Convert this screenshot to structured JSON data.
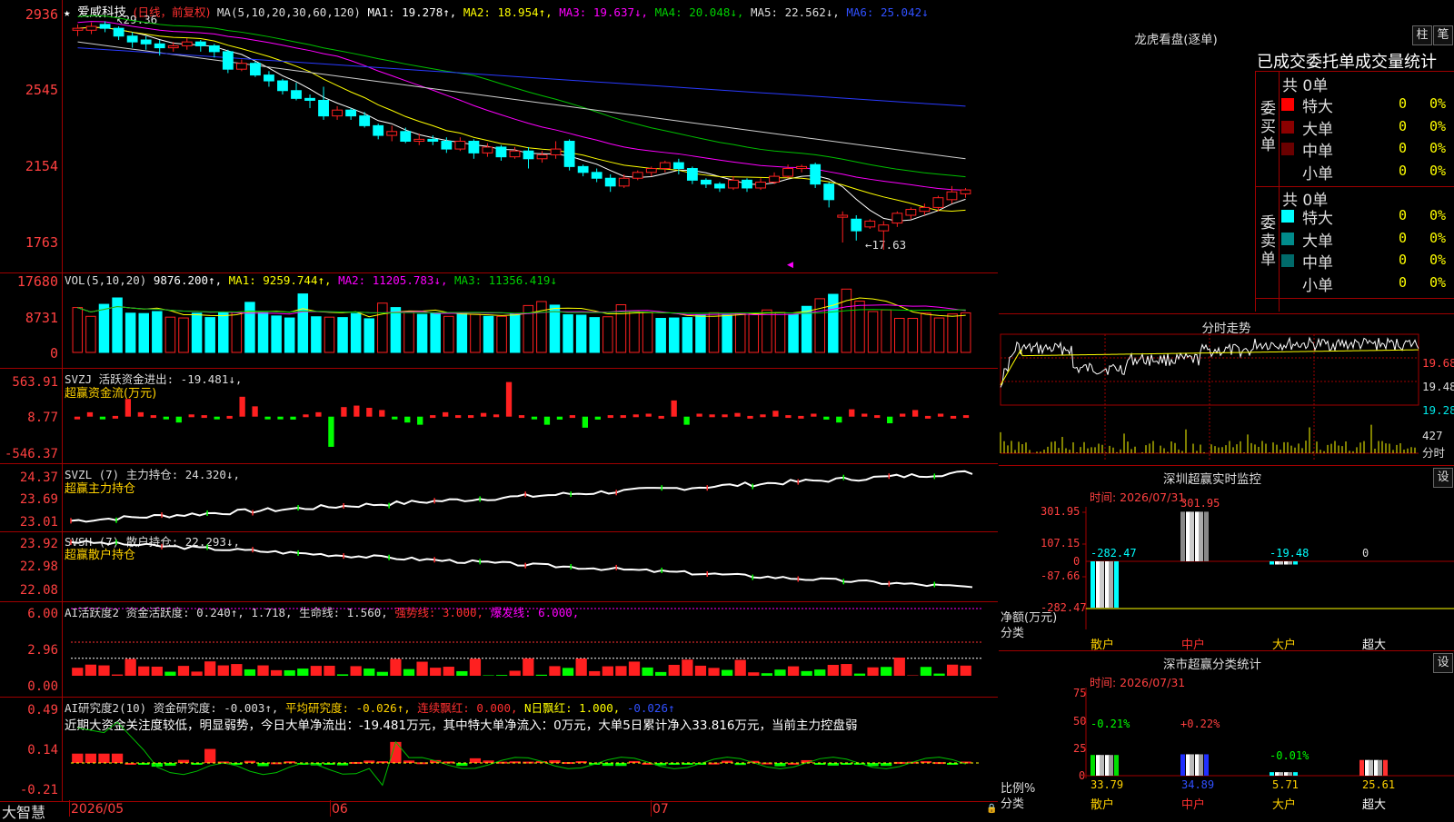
{
  "colors": {
    "up": "#ff2020",
    "down": "#00ffff",
    "ma1": "#ffffff",
    "ma2": "#ffff00",
    "ma3": "#ff00ff",
    "ma4": "#00c000",
    "ma5": "#cfcfcf",
    "ma6": "#2a3aff",
    "axis": "#ff4040",
    "grid": "#a00000"
  },
  "main": {
    "title": "爱威科技",
    "period": "(日线，前复权)",
    "ma_params": "MA(5,10,20,30,60,120)",
    "ma1": "MA1: 19.278↑,",
    "ma2": "MA2: 18.954↑,",
    "ma3": "MA3: 19.637↓,",
    "ma4": "MA4: 20.048↓,",
    "ma5": "MA5: 22.562↓,",
    "ma6": "MA6: 25.042↓",
    "high_marker": "29.36",
    "low_marker": "←17.63",
    "y_ticks": [
      "2936",
      "2545",
      "2154",
      "1763"
    ]
  },
  "vol": {
    "legend_name": "VOL(5,10,20)",
    "value": "9876.200↑,",
    "ma1": "MA1: 9259.744↑,",
    "ma2": "MA2: 11205.783↓,",
    "ma3": "MA3: 11356.419↓",
    "y_ticks": [
      "17680",
      "8731",
      "0"
    ]
  },
  "svzj": {
    "legend": "SVZJ  活跃资金进出: -19.481↓,",
    "sub": "超赢资金流(万元)",
    "y_ticks": [
      "563.91",
      "8.77",
      "-546.37"
    ]
  },
  "svzl": {
    "legend": "SVZL (7) 主力持仓: 24.320↓,",
    "sub": "超赢主力持仓",
    "y_ticks": [
      "24.37",
      "23.69",
      "23.01"
    ]
  },
  "svsh": {
    "legend": "SVSH (7) 散户持仓: 22.293↓,",
    "sub": "超赢散户持仓",
    "y_ticks": [
      "23.92",
      "22.98",
      "22.08"
    ]
  },
  "ai1": {
    "l1": "AI活跃度2 资金活跃度: 0.240↑,",
    "l2": "1.718,",
    "l3": "生命线: 1.560,",
    "l4": "强势线: 3.000,",
    "l5": "爆发线: 6.000,",
    "y_ticks": [
      "6.00",
      "2.96",
      "0.00"
    ]
  },
  "ai2": {
    "l1": "AI研究度2(10) 资金研究度: -0.003↑,",
    "l2": "平均研究度: -0.026↑,",
    "l3": "连续飘红: 0.000,",
    "l4": "N日飘红: 1.000,",
    "l5": "-0.026↑",
    "comment": "近期大资金关注度较低，明显弱势，今日大单净流出：-19.481万元，其中特大单净流入：0万元，大单5日累计净入33.816万元，当前主力控盘弱",
    "y_ticks": [
      "0.49",
      "0.14",
      "-0.21"
    ]
  },
  "bottom": {
    "brand": "大智慧",
    "dates": [
      "2026/05",
      "06",
      "07"
    ]
  },
  "dragon": {
    "title": "龙虎看盘(逐单)",
    "btn_bar": "柱",
    "btn_pen": "笔",
    "header": "已成交委托单成交量统计",
    "buy_label": "委买单",
    "sell_label": "委卖单",
    "buy_total": "共 0单",
    "sell_total": "共 0单",
    "buy_rows": [
      {
        "name": "特大",
        "count": "0",
        "pct": "0%",
        "color": "#ff0000"
      },
      {
        "name": "大单",
        "count": "0",
        "pct": "0%",
        "color": "#8b0000"
      },
      {
        "name": "中单",
        "count": "0",
        "pct": "0%",
        "color": "#6a0000"
      },
      {
        "name": "小单",
        "count": "0",
        "pct": "0%",
        "color": ""
      }
    ],
    "sell_rows": [
      {
        "name": "特大",
        "count": "0",
        "pct": "0%",
        "color": "#00ffff"
      },
      {
        "name": "大单",
        "count": "0",
        "pct": "0%",
        "color": "#008b8b"
      },
      {
        "name": "中单",
        "count": "0",
        "pct": "0%",
        "color": "#006a6a"
      },
      {
        "name": "小单",
        "count": "0",
        "pct": "0%",
        "color": ""
      }
    ]
  },
  "intraday": {
    "title": "分时走势",
    "prices": [
      "19.68",
      "19.48",
      "19.28"
    ],
    "vol_label": "427",
    "vol_unit": "分时"
  },
  "monitor": {
    "title": "深圳超赢实时监控",
    "btn": "设",
    "time": "时间: 2026/07/31",
    "y_ticks": [
      "301.95",
      "107.15",
      "0",
      "-87.66",
      "-282.47"
    ],
    "unit_label": "净额(万元)",
    "cat_label": "分类",
    "categories": [
      "散户",
      "中户",
      "大户",
      "超大"
    ],
    "values": [
      "-282.47",
      "301.95",
      "-19.48",
      "0"
    ]
  },
  "classify": {
    "title": "深市超赢分类统计",
    "btn": "设",
    "time": "时间: 2026/07/31",
    "y_ticks": [
      "75",
      "50",
      "25",
      "0"
    ],
    "unit_label": "比例%",
    "cat_label": "分类",
    "categories": [
      "散户",
      "中户",
      "大户",
      "超大"
    ],
    "changes": [
      "-0.21%",
      "+0.22%",
      "-0.01%",
      ""
    ],
    "values": [
      "33.79",
      "34.89",
      "5.71",
      "25.61"
    ]
  },
  "chart_data": [
    {
      "type": "candlestick",
      "title": "爱威科技 (日线，前复权)",
      "ylim": [
        17.3,
        29.8
      ],
      "candles": [
        [
          28.9,
          29.0,
          28.6,
          29.2
        ],
        [
          28.9,
          29.1,
          28.7,
          29.3
        ],
        [
          29.2,
          29.0,
          28.8,
          29.36
        ],
        [
          29.0,
          28.6,
          28.4,
          29.1
        ],
        [
          28.6,
          28.3,
          28.0,
          28.8
        ],
        [
          28.4,
          28.2,
          27.9,
          28.6
        ],
        [
          28.2,
          28.0,
          27.6,
          28.4
        ],
        [
          28.0,
          28.1,
          27.8,
          28.3
        ],
        [
          28.1,
          28.3,
          27.9,
          28.5
        ],
        [
          28.3,
          28.1,
          27.8,
          28.4
        ],
        [
          28.1,
          27.8,
          27.5,
          28.2
        ],
        [
          27.8,
          26.9,
          26.7,
          27.9
        ],
        [
          26.9,
          27.2,
          26.8,
          27.4
        ],
        [
          27.2,
          26.6,
          26.5,
          27.3
        ],
        [
          26.6,
          26.3,
          26.0,
          26.8
        ],
        [
          26.3,
          25.8,
          25.6,
          26.4
        ],
        [
          25.8,
          25.4,
          25.3,
          26.2
        ],
        [
          25.4,
          25.3,
          24.9,
          25.6
        ],
        [
          25.3,
          24.5,
          24.3,
          26.0
        ],
        [
          24.5,
          24.8,
          24.3,
          25.0
        ],
        [
          24.8,
          24.5,
          24.3,
          24.9
        ],
        [
          24.5,
          24.0,
          23.9,
          24.7
        ],
        [
          24.0,
          23.5,
          23.3,
          24.1
        ],
        [
          23.5,
          23.7,
          23.2,
          24.0
        ],
        [
          23.7,
          23.2,
          23.1,
          23.9
        ],
        [
          23.2,
          23.3,
          23.0,
          23.6
        ],
        [
          23.3,
          23.2,
          23.0,
          23.5
        ],
        [
          23.2,
          22.8,
          22.6,
          23.4
        ],
        [
          22.8,
          23.2,
          22.7,
          23.4
        ],
        [
          23.2,
          22.6,
          22.3,
          23.3
        ],
        [
          22.6,
          22.9,
          22.4,
          23.1
        ],
        [
          22.9,
          22.4,
          22.2,
          23.0
        ],
        [
          22.4,
          22.7,
          22.3,
          22.9
        ],
        [
          22.7,
          22.3,
          21.8,
          22.9
        ],
        [
          22.3,
          22.5,
          22.1,
          22.7
        ],
        [
          22.5,
          22.8,
          22.3,
          23.2
        ],
        [
          23.2,
          21.9,
          21.7,
          23.3
        ],
        [
          21.9,
          21.6,
          21.4,
          22.0
        ],
        [
          21.6,
          21.3,
          21.1,
          21.8
        ],
        [
          21.3,
          20.9,
          20.6,
          21.5
        ],
        [
          20.9,
          21.3,
          20.8,
          21.5
        ],
        [
          21.3,
          21.6,
          21.2,
          21.7
        ],
        [
          21.6,
          21.8,
          21.4,
          21.9
        ],
        [
          21.8,
          22.1,
          21.6,
          22.2
        ],
        [
          22.1,
          21.8,
          21.5,
          22.3
        ],
        [
          21.8,
          21.2,
          21.0,
          21.9
        ],
        [
          21.2,
          21.0,
          20.8,
          21.3
        ],
        [
          21.0,
          20.8,
          20.6,
          21.1
        ],
        [
          20.8,
          21.2,
          20.7,
          21.4
        ],
        [
          21.2,
          20.8,
          20.6,
          21.3
        ],
        [
          20.8,
          21.1,
          20.7,
          21.3
        ],
        [
          21.1,
          21.4,
          21.0,
          21.6
        ],
        [
          21.4,
          21.8,
          21.3,
          22.0
        ],
        [
          21.8,
          21.9,
          21.6,
          22.0
        ],
        [
          22.0,
          21.0,
          20.8,
          22.1
        ],
        [
          21.0,
          20.2,
          19.8,
          21.1
        ],
        [
          19.3,
          19.4,
          18.0,
          19.6
        ],
        [
          19.2,
          18.6,
          18.1,
          19.4
        ],
        [
          18.8,
          19.1,
          18.7,
          19.2
        ],
        [
          18.6,
          18.9,
          17.63,
          19.1
        ],
        [
          19.0,
          19.5,
          18.8,
          19.6
        ],
        [
          19.4,
          19.7,
          19.2,
          19.8
        ],
        [
          19.6,
          19.8,
          19.4,
          20.0
        ],
        [
          19.8,
          20.3,
          19.6,
          20.4
        ],
        [
          20.2,
          20.6,
          20.0,
          20.9
        ],
        [
          20.5,
          20.7,
          20.3,
          20.8
        ]
      ]
    },
    {
      "type": "bar",
      "title": "VOL(5,10,20)",
      "ylim": [
        0,
        17680
      ],
      "values": [
        11200,
        9000,
        12000,
        13600,
        9800,
        9700,
        10200,
        8800,
        8600,
        9800,
        8700,
        9900,
        10000,
        12500,
        9900,
        9100,
        8600,
        14600,
        8900,
        8800,
        8700,
        9700,
        8400,
        12300,
        11200,
        10100,
        9500,
        9800,
        9000,
        9600,
        9500,
        9000,
        9000,
        9700,
        11700,
        12700,
        11800,
        9400,
        9300,
        8700,
        8900,
        11900,
        10300,
        10000,
        8500,
        8600,
        8700,
        9400,
        9900,
        9300,
        9800,
        9600,
        10600,
        10000,
        9400,
        11500,
        13400,
        14500,
        15800,
        12800,
        10200,
        10600,
        8500,
        8500,
        9800,
        8600,
        9600,
        9876
      ]
    },
    {
      "type": "bar",
      "title": "超赢资金流(万元)",
      "ylim": [
        -546.37,
        563.91
      ],
      "values": [
        0,
        60,
        -20,
        10,
        240,
        60,
        20,
        -20,
        -80,
        30,
        20,
        -20,
        10,
        270,
        140,
        -20,
        -10,
        -40,
        30,
        60,
        -410,
        130,
        150,
        120,
        90,
        -20,
        -80,
        -110,
        20,
        60,
        20,
        20,
        50,
        30,
        470,
        20,
        -20,
        -110,
        -40,
        20,
        -150,
        -40,
        20,
        20,
        30,
        40,
        10,
        220,
        -110,
        40,
        30,
        30,
        50,
        10,
        30,
        80,
        20,
        10,
        40,
        -40,
        -80,
        100,
        40,
        20,
        -90,
        40,
        90,
        10,
        40,
        10,
        20
      ]
    },
    {
      "type": "line",
      "title": "超赢主力持仓",
      "ylim": [
        23.01,
        24.37
      ]
    },
    {
      "type": "line",
      "title": "超赢散户持仓",
      "ylim": [
        22.08,
        23.92
      ]
    }
  ]
}
